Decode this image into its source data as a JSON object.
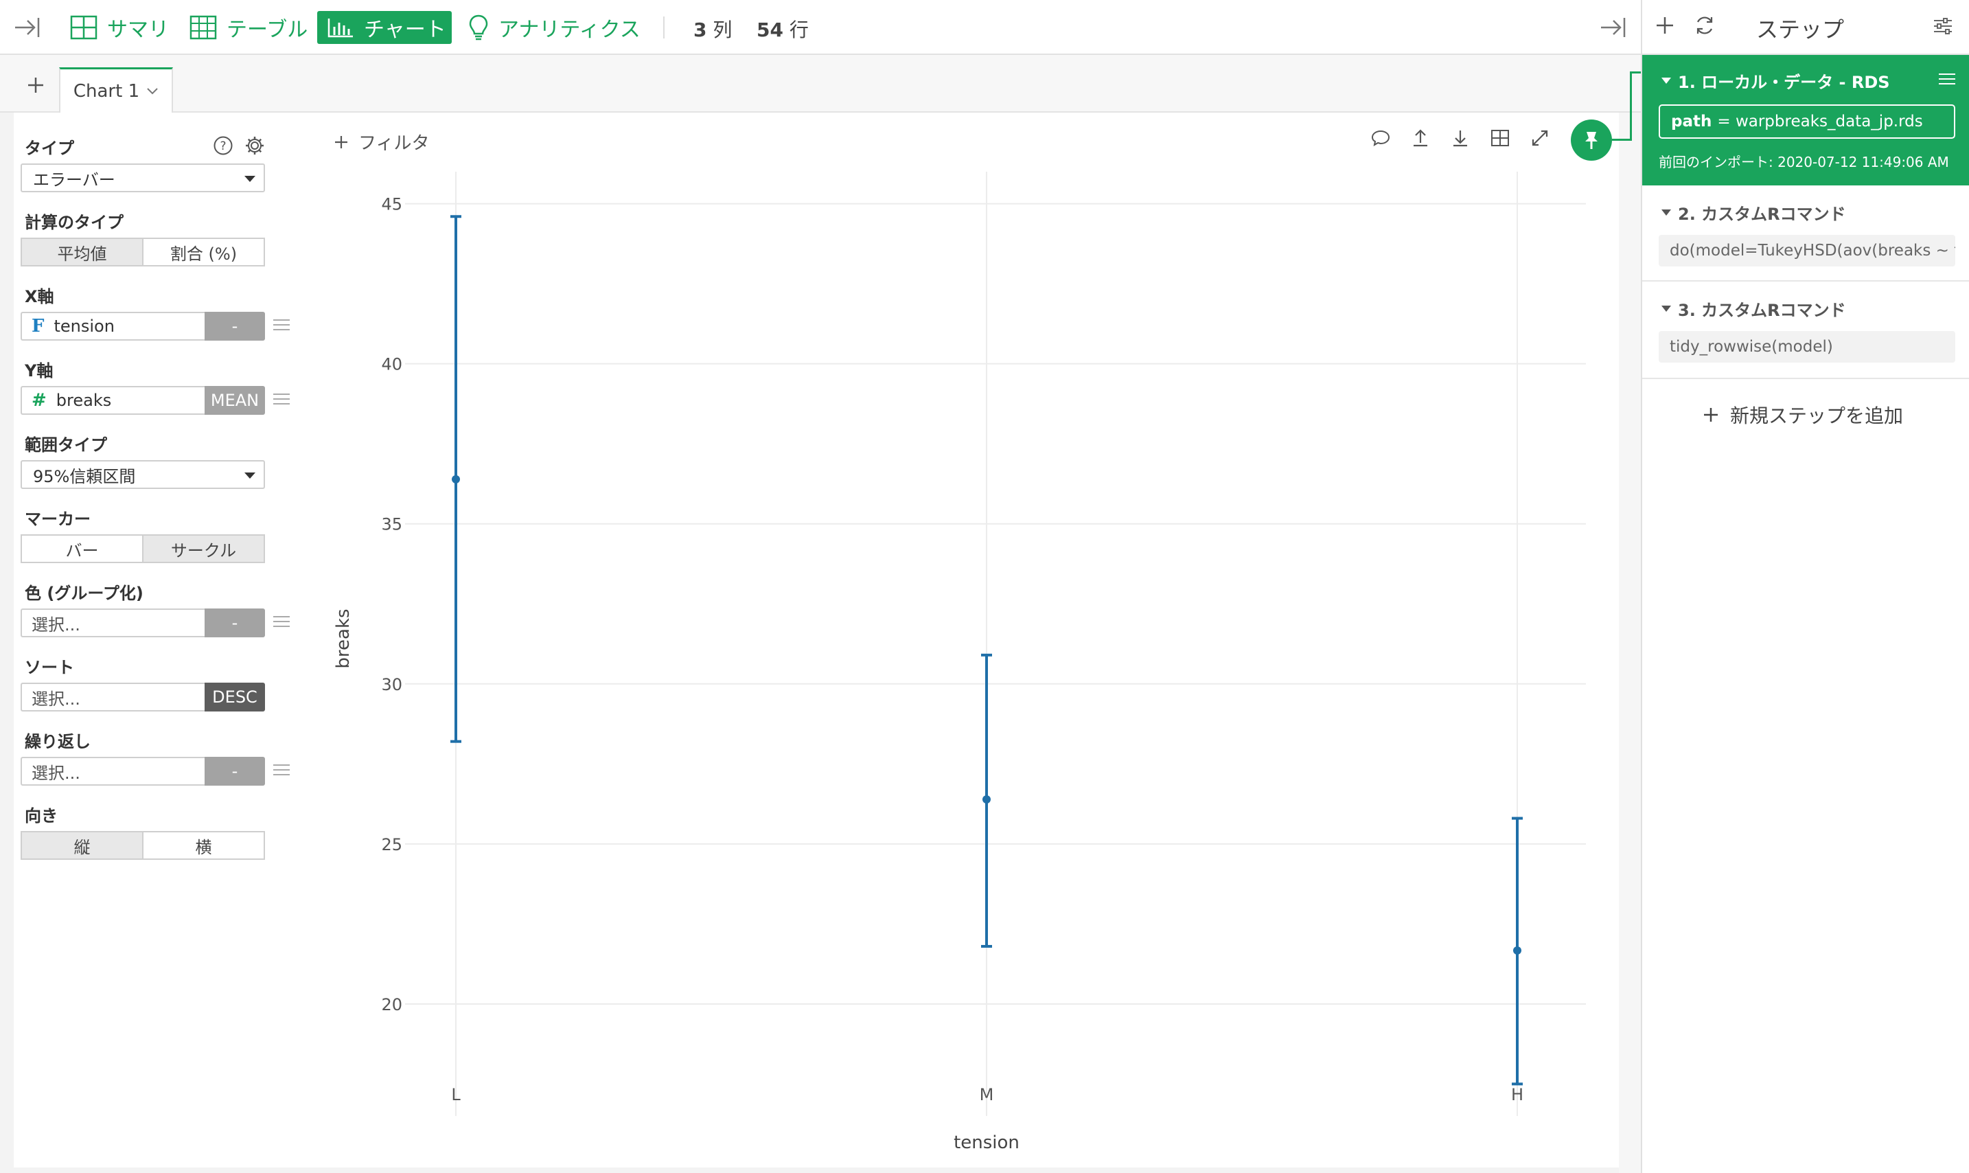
{
  "topbar": {
    "tabs": [
      {
        "label": "サマリ",
        "icon": "grid-icon"
      },
      {
        "label": "テーブル",
        "icon": "table-icon"
      },
      {
        "label": "チャート",
        "icon": "bar-chart-icon",
        "active": true
      },
      {
        "label": "アナリティクス",
        "icon": "lightbulb-icon"
      }
    ],
    "columns_count": "3",
    "columns_unit": "列",
    "rows_count": "54",
    "rows_unit": "行"
  },
  "chart_tabs": {
    "active_tab": "Chart 1",
    "add_icon": "plus-icon"
  },
  "config": {
    "type_label": "タイプ",
    "type_value": "エラーバー",
    "calc_label": "計算のタイプ",
    "calc_options": [
      "平均値",
      "割合 (%)"
    ],
    "calc_selected": "平均値",
    "x_label": "X軸",
    "x_type_icon": "F",
    "x_field": "tension",
    "x_agg": "-",
    "y_label": "Y軸",
    "y_type_icon": "#",
    "y_field": "breaks",
    "y_agg": "MEAN",
    "range_label": "範囲タイプ",
    "range_value": "95%信頼区間",
    "marker_label": "マーカー",
    "marker_options": [
      "バー",
      "サークル"
    ],
    "marker_selected": "サークル",
    "color_label": "色 (グループ化)",
    "color_placeholder": "選択...",
    "color_agg": "-",
    "sort_label": "ソート",
    "sort_placeholder": "選択...",
    "sort_order": "DESC",
    "repeat_label": "繰り返し",
    "repeat_placeholder": "選択...",
    "repeat_agg": "-",
    "orient_label": "向き",
    "orient_options": [
      "縦",
      "横"
    ],
    "orient_selected": "縦"
  },
  "filter": {
    "label": "フィルタ"
  },
  "colors": {
    "accent": "#1aa45c",
    "series": "#1f6fa8",
    "grid": "#ececec"
  },
  "chart_data": {
    "type": "errorbar",
    "categories": [
      "L",
      "M",
      "H"
    ],
    "mean": [
      36.39,
      26.39,
      21.67
    ],
    "lower": [
      28.2,
      21.8,
      17.5
    ],
    "upper": [
      44.6,
      30.9,
      25.8
    ],
    "xlabel": "tension",
    "ylabel": "breaks",
    "yticks": [
      20,
      25,
      30,
      35,
      40,
      45
    ],
    "ylim": [
      16.5,
      46
    ],
    "grid": true
  },
  "steps_panel": {
    "title": "ステップ",
    "steps": [
      {
        "title": "1. ローカル・データ - RDS",
        "param_key": "path",
        "param_value": "= warpbreaks_data_jp.rds",
        "meta": "前回のインポート: 2020-07-12 11:49:06 AM"
      },
      {
        "title": "2. カスタムRコマンド",
        "command": "do(model=TukeyHSD(aov(breaks ~ tension, data = .)))"
      },
      {
        "title": "3. カスタムRコマンド",
        "command": "tidy_rowwise(model)"
      }
    ],
    "add_step_label": "新規ステップを追加"
  }
}
